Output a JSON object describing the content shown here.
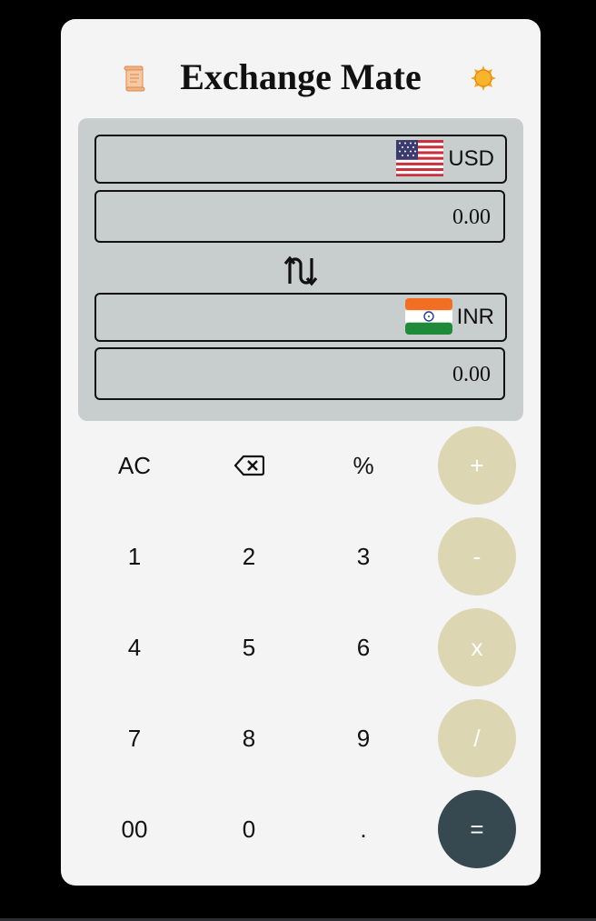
{
  "header": {
    "title": "Exchange Mate",
    "history_icon": "scroll-icon",
    "theme_icon": "sun-icon"
  },
  "converter": {
    "from_currency": {
      "code": "USD",
      "flag": "us-flag-icon"
    },
    "from_amount": "0.00",
    "swap_icon": "swap-arrows-icon",
    "to_currency": {
      "code": "INR",
      "flag": "india-flag-icon"
    },
    "to_amount": "0.00"
  },
  "keypad": {
    "clear": "AC",
    "backspace_icon": "backspace-icon",
    "percent": "%",
    "add": "+",
    "subtract": "-",
    "multiply": "x",
    "divide": "/",
    "equals": "=",
    "digits": [
      "1",
      "2",
      "3",
      "4",
      "5",
      "6",
      "7",
      "8",
      "9",
      "00",
      "0",
      "."
    ]
  },
  "colors": {
    "background": "#000000",
    "card": "#f4f4f4",
    "panel": "#c8cdcd",
    "operator_key": "#ddd6b3",
    "equals_key": "#364850"
  }
}
